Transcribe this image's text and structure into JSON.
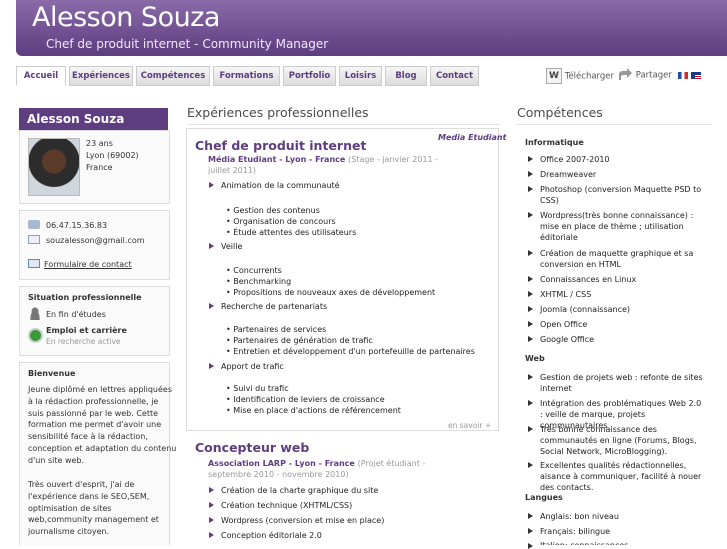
{
  "header": {
    "name": "Alesson Souza",
    "tagline": "Chef de produit internet - Community Manager"
  },
  "nav": {
    "items": [
      "Accueil",
      "Expériences",
      "Compétences",
      "Formations",
      "Portfolio",
      "Loisirs",
      "Blog",
      "Contact"
    ],
    "active": "Accueil"
  },
  "tools": {
    "download": "Télécharger",
    "share": "Partager",
    "download_icon": "W"
  },
  "profile": {
    "name": "Alesson Souza",
    "age": "23 ans",
    "city": "Lyon (69002)",
    "country": "France",
    "phone": "06.47.15.36.83",
    "email": "souzalesson@gmail.com",
    "contact_link": "Formulaire de contact"
  },
  "situation": {
    "title": "Situation professionnelle",
    "status": "En fin d'études",
    "job_title": "Emploi et carrière",
    "job_status": "En recherche active"
  },
  "bio": {
    "title": "Bienvenue",
    "p1": [
      "Jeune diplômé en lettres appliquées",
      "à la rédaction professionnelle, je",
      "suis passionné par le web. Cette",
      "formation me permet d'avoir une",
      "sensibilité face à la rédaction,",
      "conception et adaptation du contenu",
      "d'un site web."
    ],
    "p2": [
      "Très ouvert d'esprit, j'ai de",
      "l'expérience dans le SEO,SEM,",
      "optimisation de sites",
      "web,community management et",
      "journalisme citoyen."
    ]
  },
  "experiences": {
    "title": "Expériences professionnelles",
    "job1": {
      "title": "Chef de produit internet",
      "org": "Média Etudiant - Lyon - France",
      "period": "(Stage - janvier 2011 - juillet 2011)",
      "logo_a": "Media",
      "logo_b": "Etudiant",
      "items": [
        {
          "label": "Animation de la communauté",
          "subs": [
            "• Gestion des contenus",
            "• Organisation de concours",
            "• Étude attentes des utilisateurs"
          ]
        },
        {
          "label": "Veille",
          "subs": [
            "• Concurrents",
            "• Benchmarking",
            "• Propositions de nouveaux axes de développement"
          ]
        },
        {
          "label": "Recherche de partenariats",
          "subs": [
            "• Partenaires de services",
            "• Partenaires de génération de trafic",
            "• Entretien et développement d'un portefeuille de partenaires"
          ]
        },
        {
          "label": "Apport de trafic",
          "subs": [
            "• Suivi du trafic",
            "• Identification de leviers de croissance",
            "• Mise en place d'actions de référencement"
          ]
        }
      ],
      "more": "en savoir +"
    },
    "job2": {
      "title": "Concepteur web",
      "org": "Association LARP - Lyon - France",
      "period": "(Projet étudiant - septembre 2010 - novembre 2010)",
      "items": [
        "Création de la charte graphique du site",
        "Création technique (XHTML/CSS)",
        "Wordpress (conversion et mise en place)",
        "Conception éditoriale 2.0"
      ]
    }
  },
  "skills": {
    "title": "Compétences",
    "informatique": {
      "title": "Informatique",
      "items": [
        "Office 2007-2010",
        "Dreamweaver",
        "Photoshop (conversion Maquette PSD to CSS)",
        "Wordpress(très bonne connaissance) : mise en place de thème ; utilisation éditoriale",
        "Création de maquette graphique et sa conversion en HTML",
        "Connaissances en Linux",
        "XHTML / CSS",
        "Joomla (connaissance)",
        "Open Office",
        "Google Office"
      ]
    },
    "web": {
      "title": "Web",
      "items": [
        "Gestion de projets web : refonte de sites internet",
        "Intégration des problématiques Web 2.0 : veille de marque, projets communautaires",
        "Très bonne connaissance des communautés en ligne (Forums, Blogs, Social Network, MicroBlogging).",
        "Excellentes qualités rédactionnelles, aisance à communiquer, facilité à nouer des contacts."
      ]
    },
    "langues": {
      "title": "Langues",
      "items": [
        "Anglais: bon niveau",
        "Français: bilingue",
        "Italien: connaissances"
      ]
    }
  },
  "colors": {
    "accent": "#5e3d80",
    "header_top": "#8a6aa8"
  }
}
